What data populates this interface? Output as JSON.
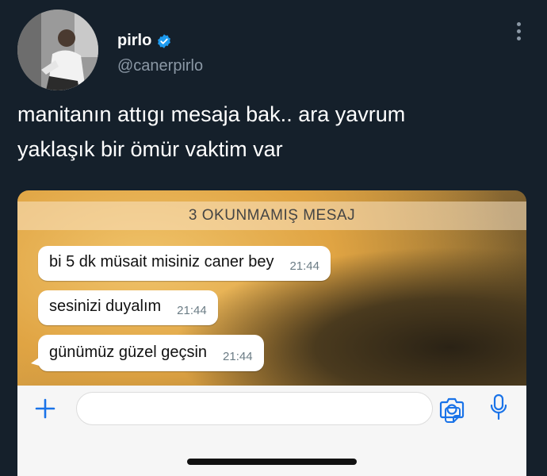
{
  "tweet": {
    "display_name": "pirlo",
    "handle": "@canerpirlo",
    "verified": true,
    "text_line1": "manitanın attıgı mesaja bak.. ara yavrum",
    "text_line2": "yaklaşık bir ömür vaktim var",
    "icons": {
      "verified": "verified-badge-icon",
      "more": "more-vertical-icon"
    },
    "colors": {
      "background": "#15202b",
      "verified": "#1d9bf0",
      "handle": "#8b98a5"
    }
  },
  "chat": {
    "unread_banner": "3 OKUNMAMIŞ MESAJ",
    "messages": [
      {
        "text": "bi 5 dk müsait misiniz caner bey",
        "time": "21:44"
      },
      {
        "text": "sesinizi duyalım",
        "time": "21:44"
      },
      {
        "text": "günümüz güzel geçsin",
        "time": "21:44"
      }
    ],
    "input_icons": [
      "plus-icon",
      "sticker-icon",
      "camera-icon",
      "microphone-icon"
    ],
    "colors": {
      "accent": "#1a73e8",
      "bubble": "#ffffff"
    }
  }
}
